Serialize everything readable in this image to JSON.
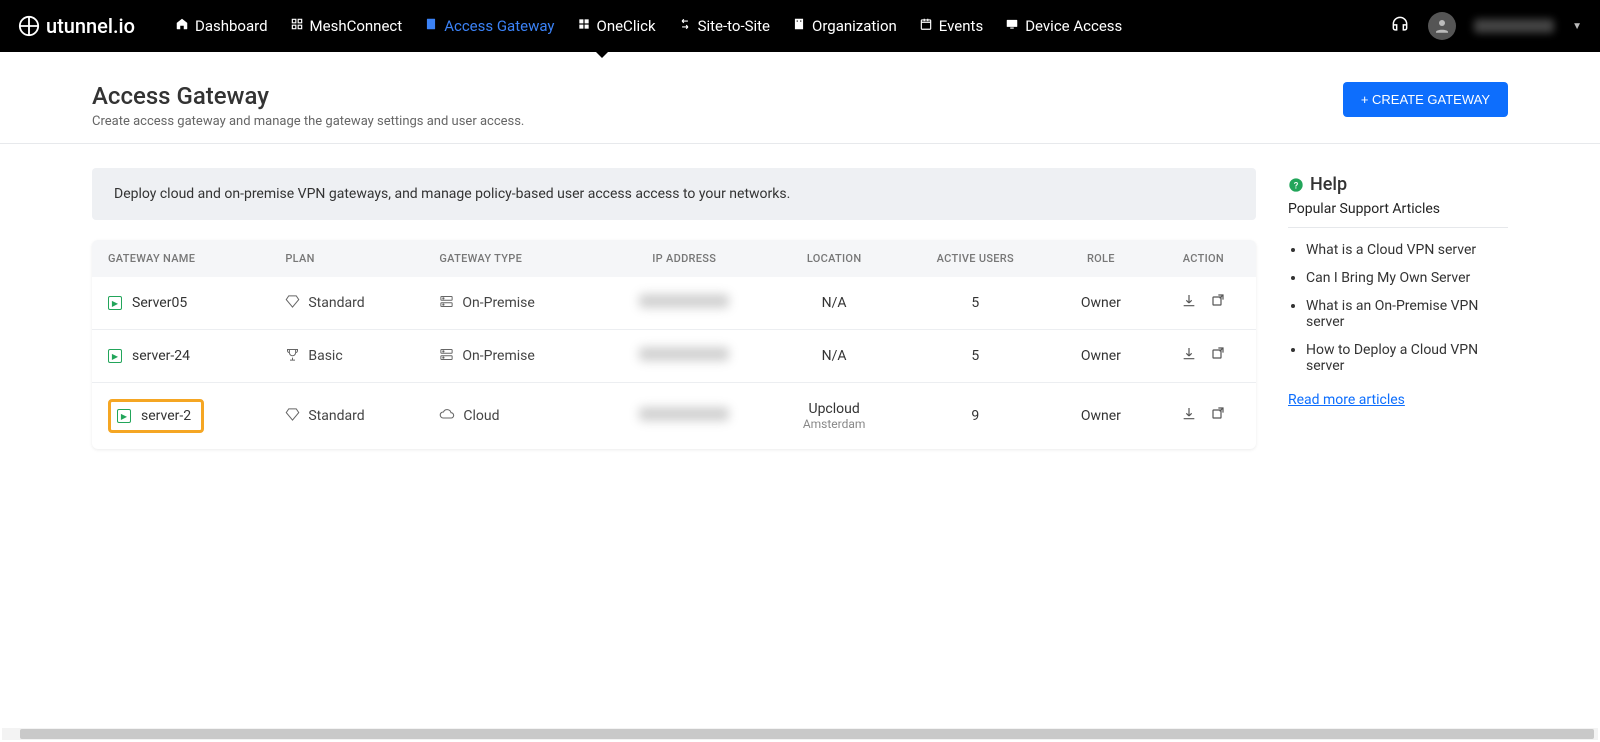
{
  "brand": "utunnel.io",
  "nav": [
    {
      "label": "Dashboard"
    },
    {
      "label": "MeshConnect"
    },
    {
      "label": "Access Gateway",
      "active": true
    },
    {
      "label": "OneClick"
    },
    {
      "label": "Site-to-Site"
    },
    {
      "label": "Organization"
    },
    {
      "label": "Events"
    },
    {
      "label": "Device Access"
    }
  ],
  "page": {
    "title": "Access Gateway",
    "subtitle": "Create access gateway and manage the gateway settings and user access.",
    "create_btn": "+ CREATE GATEWAY",
    "banner": "Deploy cloud and on-premise VPN gateways, and manage policy-based user access access to your networks."
  },
  "table": {
    "headers": [
      "GATEWAY NAME",
      "PLAN",
      "GATEWAY TYPE",
      "IP ADDRESS",
      "LOCATION",
      "ACTIVE USERS",
      "ROLE",
      "ACTION"
    ],
    "rows": [
      {
        "name": "Server05",
        "plan": "Standard",
        "plan_icon": "diamond",
        "type": "On-Premise",
        "type_icon": "server",
        "ip": "(redacted)",
        "location": "N/A",
        "location_sub": "",
        "users": "5",
        "role": "Owner",
        "highlight": false
      },
      {
        "name": "server-24",
        "plan": "Basic",
        "plan_icon": "trophy",
        "type": "On-Premise",
        "type_icon": "server",
        "ip": "(redacted)",
        "location": "N/A",
        "location_sub": "",
        "users": "5",
        "role": "Owner",
        "highlight": false
      },
      {
        "name": "server-2",
        "plan": "Standard",
        "plan_icon": "diamond",
        "type": "Cloud",
        "type_icon": "cloud",
        "ip": "(redacted)",
        "location": "Upcloud",
        "location_sub": "Amsterdam",
        "users": "9",
        "role": "Owner",
        "highlight": true
      }
    ]
  },
  "help": {
    "title": "Help",
    "subtitle": "Popular Support Articles",
    "items": [
      "What is a Cloud VPN server",
      "Can I Bring My Own Server",
      "What is an On-Premise VPN server",
      "How to Deploy a Cloud VPN server"
    ],
    "more": "Read more articles"
  }
}
